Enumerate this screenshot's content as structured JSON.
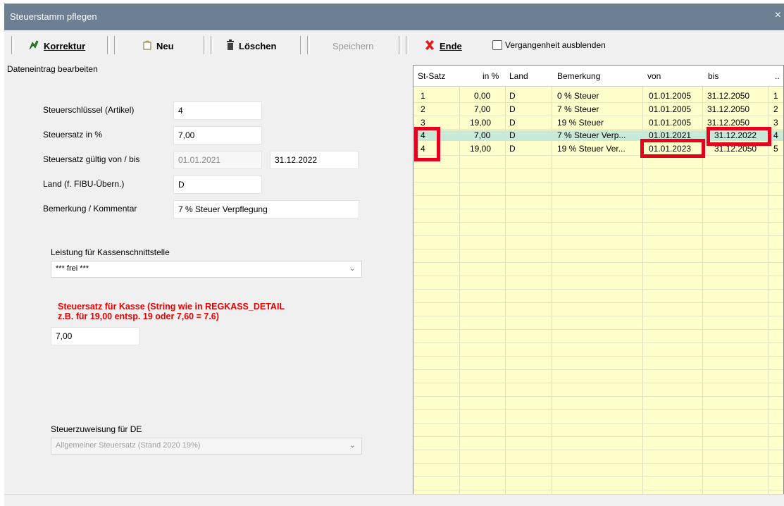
{
  "window": {
    "title": "Steuerstamm pflegen",
    "close": "×"
  },
  "toolbar": {
    "korrektur": "Korrektur",
    "neu": "Neu",
    "loeschen": "Löschen",
    "speichern": "Speichern",
    "ende": "Ende",
    "vergangenheit": "Vergangenheit ausblenden"
  },
  "form": {
    "group_label": "Dateneintrag bearbeiten",
    "steuerschluessel_label": "Steuerschlüssel (Artikel)",
    "steuerschluessel_value": "4",
    "steuersatz_label": "Steuersatz in %",
    "steuersatz_value": "7,00",
    "gueltig_label": "Steuersatz gültig von / bis",
    "von_value": "01.01.2021",
    "bis_value": "31.12.2022",
    "land_label": "Land (f. FIBU-Übern.)",
    "land_value": "D",
    "bemerkung_label": "Bemerkung / Kommentar",
    "bemerkung_value": "7 % Steuer Verpflegung",
    "leistung_label": "Leistung für Kassenschnittstelle",
    "leistung_value": "*** frei ***",
    "kasse_line1": "Steuersatz für Kasse (String wie in REGKASS_DETAIL",
    "kasse_line2": "z.B. für 19,00 entsp. 19 oder 7,60 = 7.6)",
    "kasse_value": "7,00",
    "zuweisung_label": "Steuerzuweisung für DE",
    "zuweisung_value": "Allgemeiner Steuersatz (Stand 2020 19%)"
  },
  "grid": {
    "columns": [
      "St-Satz",
      "in %",
      "Land",
      "Bemerkung",
      "von",
      "bis",
      ".."
    ],
    "rows": [
      {
        "satz": "1",
        "pct": "0,00",
        "land": "D",
        "bem": "0 % Steuer",
        "von": "01.01.2005",
        "bis": "31.12.2050",
        "x": "1"
      },
      {
        "satz": "2",
        "pct": "7,00",
        "land": "D",
        "bem": "7 % Steuer",
        "von": "01.01.2005",
        "bis": "31.12.2050",
        "x": "2"
      },
      {
        "satz": "3",
        "pct": "19,00",
        "land": "D",
        "bem": "19 % Steuer",
        "von": "01.01.2005",
        "bis": "31.12.2050",
        "x": "3"
      },
      {
        "satz": "4",
        "pct": "7,00",
        "land": "D",
        "bem": "7 % Steuer Verp...",
        "von": "01.01.2021",
        "bis": "31.12.2022",
        "x": "4"
      },
      {
        "satz": "4",
        "pct": "19,00",
        "land": "D",
        "bem": "19 % Steuer Ver...",
        "von": "01.01.2023",
        "bis": "31.12.2050",
        "x": "5"
      }
    ]
  },
  "colors": {
    "grid_bg": "#ffffcc",
    "selected_row": "#c8e8d8",
    "highlight": "#e6001e",
    "title_bar": "#6c7f93",
    "warning_text": "#e60000"
  }
}
